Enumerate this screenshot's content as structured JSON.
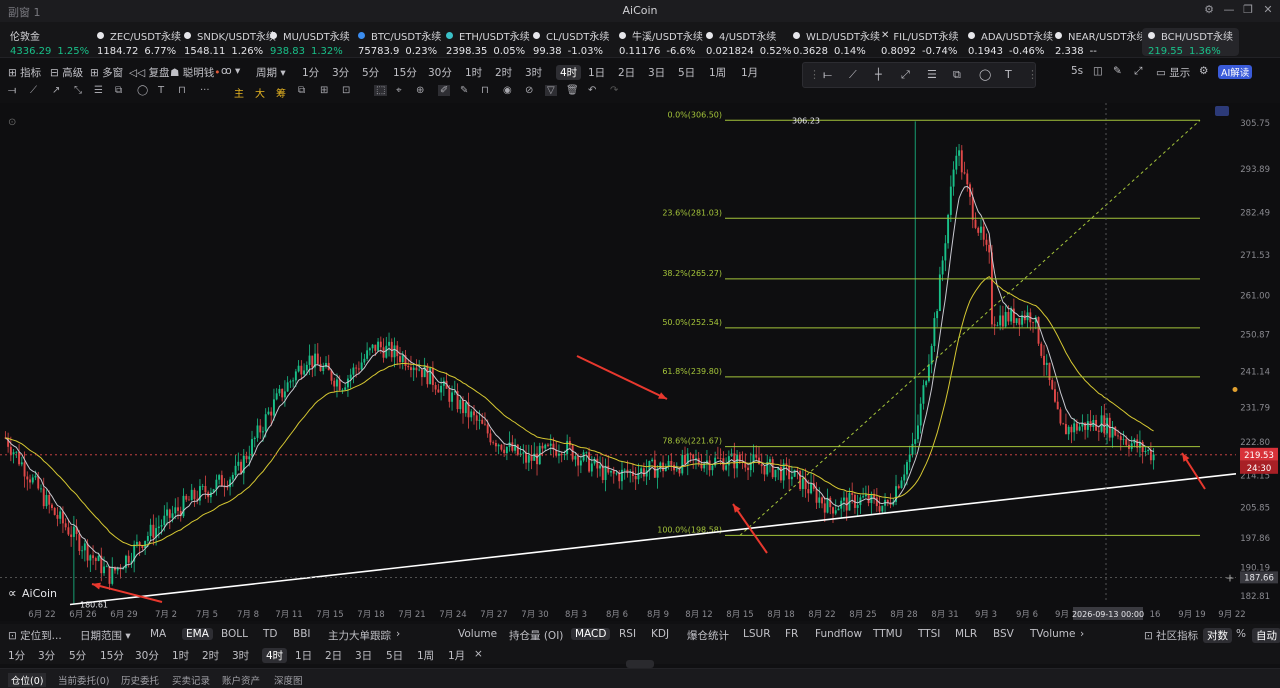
{
  "window": {
    "left_title": "副窗 1",
    "title": "AiCoin"
  },
  "ticker": [
    {
      "name": "伦敦金",
      "price": "4336.29",
      "change": "1.25%",
      "dir": "up",
      "dot": ""
    },
    {
      "name": "ZEC/USDT永续",
      "price": "1184.72",
      "change": "6.77%",
      "dir": "flat",
      "dot": "#e6e6ea"
    },
    {
      "name": "SNDK/USDT永续",
      "price": "1548.11",
      "change": "1.26%",
      "dir": "flat",
      "dot": "#e6e6ea"
    },
    {
      "name": "MU/USDT永续",
      "price": "938.83",
      "change": "1.32%",
      "dir": "up",
      "dot": "#e6e6ea"
    },
    {
      "name": "BTC/USDT永续",
      "price": "75783.9",
      "change": "0.23%",
      "dir": "flat",
      "dot": "#3b8df0"
    },
    {
      "name": "ETH/USDT永续",
      "price": "2398.35",
      "change": "0.05%",
      "dir": "flat",
      "dot": "#3bc1c8"
    },
    {
      "name": "CL/USDT永续",
      "price": "99.38",
      "change": "-1.03%",
      "dir": "flat",
      "dot": "#e6e6ea"
    },
    {
      "name": "牛溪/USDT永续",
      "price": "0.11176",
      "change": "-6.6%",
      "dir": "flat",
      "dot": "#e6e6ea"
    },
    {
      "name": "4/USDT永续",
      "price": "0.021824",
      "change": "0.52%",
      "dir": "flat",
      "dot": "#e6e6ea"
    },
    {
      "name": "WLD/USDT永续",
      "price": "0.3628",
      "change": "0.14%",
      "dir": "flat",
      "dot": "#e6e6ea"
    },
    {
      "name": "FIL/USDT永续",
      "price": "0.8092",
      "change": "-0.74%",
      "dir": "flat",
      "dot": "x"
    },
    {
      "name": "ADA/USDT永续",
      "price": "0.1943",
      "change": "-0.46%",
      "dir": "flat",
      "dot": "#e6e6ea"
    },
    {
      "name": "NEAR/USDT永续",
      "price": "2.338",
      "change": "--",
      "dir": "flat",
      "dot": "#e6e6ea"
    },
    {
      "name": "BCH/USDT永续",
      "price": "219.55",
      "change": "1.36%",
      "dir": "up",
      "dot": "#e6e6ea"
    }
  ],
  "toolbar": {
    "indicators": "指标",
    "advanced": "高级",
    "multi": "多窗",
    "replay": "复盘",
    "smart": "聪明钱",
    "period": "周期",
    "intervals": [
      "1分",
      "3分",
      "5分",
      "15分",
      "30分",
      "1时",
      "2时",
      "3时",
      "4时",
      "1日",
      "2日",
      "3日",
      "5日",
      "1周",
      "1月"
    ],
    "selected_interval": "4时",
    "refresh": "5s",
    "display": "显示",
    "ai": "AI解读"
  },
  "toolbar2": {
    "items": [
      "主",
      "大",
      "筹"
    ]
  },
  "chart_data": {
    "type": "candlestick",
    "x_ticks": [
      "6月 22",
      "6月 26",
      "6月 29",
      "7月 2",
      "7月 5",
      "7月 8",
      "7月 11",
      "7月 15",
      "7月 18",
      "7月 21",
      "7月 24",
      "7月 27",
      "7月 30",
      "8月 3",
      "8月 6",
      "8月 9",
      "8月 12",
      "8月 15",
      "8月 18",
      "8月 22",
      "8月 25",
      "8月 28",
      "8月 31",
      "9月 3",
      "9月 6",
      "9月",
      "16",
      "9月 19",
      "9月 22"
    ],
    "y_ticks": [
      "305.75",
      "293.89",
      "282.49",
      "271.53",
      "261.00",
      "250.87",
      "241.14",
      "231.79",
      "222.80",
      "214.15",
      "205.85",
      "197.86",
      "190.19",
      "182.81"
    ],
    "ylim": [
      181,
      311
    ],
    "fib_levels": [
      {
        "label": "0.0%(306.50)",
        "value": 306.5
      },
      {
        "label": "23.6%(281.03)",
        "value": 281.03
      },
      {
        "label": "38.2%(265.27)",
        "value": 265.27
      },
      {
        "label": "50.0%(252.54)",
        "value": 252.54
      },
      {
        "label": "61.8%(239.80)",
        "value": 239.8
      },
      {
        "label": "78.6%(221.67)",
        "value": 221.67
      },
      {
        "label": "100.0%(198.58)",
        "value": 198.58
      }
    ],
    "high_label": "306.23",
    "low_label": "180.61",
    "last_price": "219.53",
    "countdown": "24:30",
    "crosshair_price": "187.66",
    "crosshair_date": "2026-09-13 00:00",
    "watermark": "AiCoin"
  },
  "indicators_bar": {
    "position_btn": "定位到...",
    "date_range": "日期范围",
    "main": [
      "MA",
      "EMA",
      "BOLL",
      "TD",
      "BBI",
      "主力大单跟踪"
    ],
    "main_selected": "EMA",
    "sub": [
      "Volume",
      "持仓量 (OI)",
      "MACD",
      "RSI",
      "KDJ",
      "爆仓统计",
      "LSUR",
      "FR",
      "Fundflow",
      "TTMU",
      "TTSI",
      "MLR",
      "BSV",
      "TVolume"
    ],
    "sub_selected": "MACD",
    "community": "社区指标",
    "compare": "对数",
    "percent": "%",
    "auto": "自动"
  },
  "intervals_bar": [
    "1分",
    "3分",
    "5分",
    "15分",
    "30分",
    "1时",
    "2时",
    "3时",
    "4时",
    "1日",
    "2日",
    "3日",
    "5日",
    "1周",
    "1月"
  ],
  "bottom_tabs": [
    "仓位(0)",
    "当前委托(0)",
    "历史委托",
    "买卖记录",
    "账户资产",
    "深度图"
  ]
}
